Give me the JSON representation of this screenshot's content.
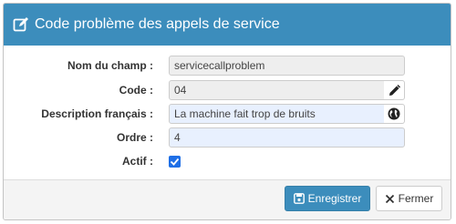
{
  "modal": {
    "title": "Code problème des appels de service",
    "title_icon": "edit-icon"
  },
  "form": {
    "field_name": {
      "label": "Nom du champ :",
      "value": "servicecallproblem"
    },
    "code": {
      "label": "Code :",
      "value": "04",
      "addon_icon": "pencil-icon"
    },
    "description_fr": {
      "label": "Description français :",
      "value": "La machine fait trop de bruits",
      "addon_icon": "globe-icon"
    },
    "order": {
      "label": "Ordre :",
      "value": "4"
    },
    "active": {
      "label": "Actif :",
      "checked": true
    }
  },
  "footer": {
    "save_label": "Enregistrer",
    "save_icon": "save-icon",
    "close_label": "Fermer",
    "close_icon": "close-icon"
  },
  "colors": {
    "header": "#3c8dbc",
    "primary_button": "#3c8dbc",
    "checkbox": "#1f6fe6",
    "editable_field": "#e8f0fe",
    "readonly_field": "#eeeeee"
  }
}
